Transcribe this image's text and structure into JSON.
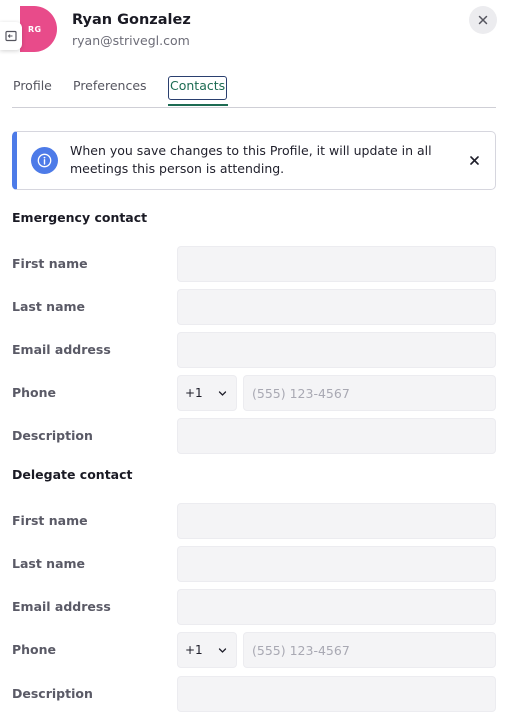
{
  "profile": {
    "initials": "RG",
    "name": "Ryan Gonzalez",
    "email": "ryan@strivegl.com"
  },
  "tabs": [
    {
      "label": "Profile",
      "active": false
    },
    {
      "label": "Preferences",
      "active": false
    },
    {
      "label": "Contacts",
      "active": true
    }
  ],
  "banner": {
    "message": "When you save changes to this Profile, it will update in all meetings this person is attending."
  },
  "emergency": {
    "title": "Emergency contact",
    "first_name_label": "First name",
    "first_name_value": "",
    "last_name_label": "Last name",
    "last_name_value": "",
    "email_label": "Email address",
    "email_value": "",
    "phone_label": "Phone",
    "country_code": "+1",
    "phone_placeholder": "(555) 123-4567",
    "description_label": "Description",
    "description_value": ""
  },
  "delegate": {
    "title": "Delegate contact",
    "first_name_label": "First name",
    "first_name_value": "",
    "last_name_label": "Last name",
    "last_name_value": "",
    "email_label": "Email address",
    "email_value": "",
    "phone_label": "Phone",
    "country_code": "+1",
    "phone_placeholder": "(555) 123-4567",
    "description_label": "Description",
    "description_value": ""
  },
  "colors": {
    "avatar": "#e84b8a",
    "active_tab": "#1c6b52",
    "info_accent": "#4d7be8"
  },
  "icons": {
    "edge_tab": "collapse-panel-icon",
    "close": "close-icon",
    "banner": "info-icon",
    "banner_close": "close-icon",
    "select": "chevron-down-icon"
  }
}
